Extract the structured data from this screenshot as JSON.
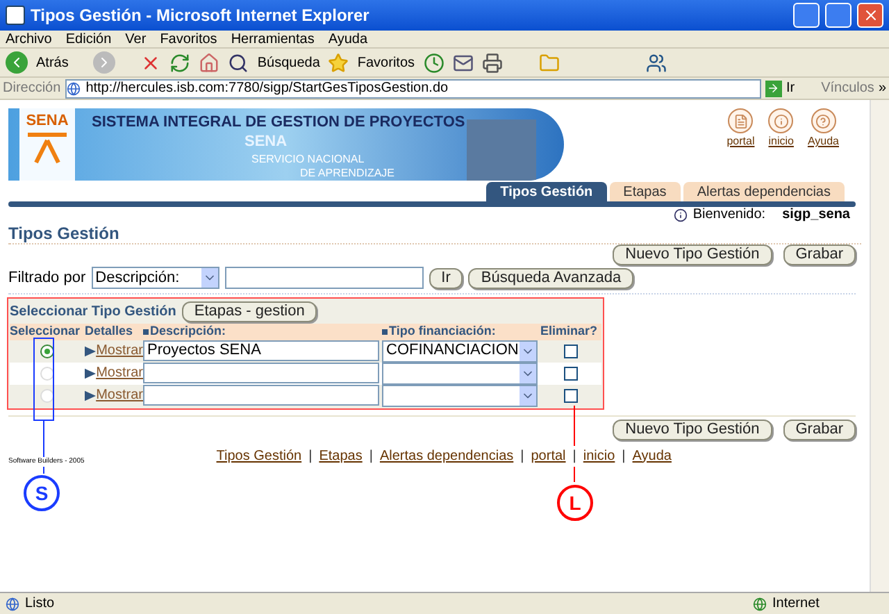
{
  "window": {
    "title": "Tipos Gestión - Microsoft Internet Explorer"
  },
  "menu": [
    "Archivo",
    "Edición",
    "Ver",
    "Favoritos",
    "Herramientas",
    "Ayuda"
  ],
  "toolbar": {
    "back": "Atrás",
    "search": "Búsqueda",
    "favorites": "Favoritos"
  },
  "address_bar": {
    "label": "Dirección",
    "url": "http://hercules.isb.com:7780/sigp/StartGesTiposGestion.do",
    "go": "Ir",
    "links": "Vínculos",
    "more": "»"
  },
  "banner": {
    "logo": "SENA",
    "title": "SISTEMA INTEGRAL DE GESTION DE PROYECTOS",
    "subtitle": "SENA",
    "line_1": "SERVICIO NACIONAL",
    "line_2": "DE APRENDIZAJE"
  },
  "header_links": [
    "portal",
    "inicio",
    "Ayuda"
  ],
  "tabs": [
    {
      "label": "Tipos Gestión",
      "selected": true
    },
    {
      "label": "Etapas",
      "selected": false
    },
    {
      "label": "Alertas dependencias",
      "selected": false
    }
  ],
  "welcome": {
    "label": "Bienvenido:",
    "user": "sigp_sena"
  },
  "page_title": "Tipos Gestión",
  "top_actions": [
    "Nuevo Tipo Gestión",
    "Grabar"
  ],
  "filter": {
    "label": "Filtrado por",
    "field": "Descripción:",
    "go": "Ir",
    "advanced": "Búsqueda Avanzada"
  },
  "table": {
    "caption": "Seleccionar Tipo Gestión",
    "caption_button": "Etapas - gestion",
    "columns": [
      "Seleccionar",
      "Detalles",
      "Descripción:",
      "Tipo financiación:",
      "Eliminar?"
    ],
    "rows": [
      {
        "selected": true,
        "details": "Mostrar",
        "description": "Proyectos SENA",
        "financing": "COFINANCIACION",
        "delete": false
      },
      {
        "selected": false,
        "details": "Mostrar",
        "description": "",
        "financing": "",
        "delete": false
      },
      {
        "selected": false,
        "details": "Mostrar",
        "description": "",
        "financing": "",
        "delete": false
      }
    ]
  },
  "bottom_actions": [
    "Nuevo Tipo Gestión",
    "Grabar"
  ],
  "copyright": "Software Builders - 2005",
  "footer_links": [
    "Tipos Gestión",
    "Etapas",
    "Alertas dependencias",
    "portal",
    "inicio",
    "Ayuda"
  ],
  "footer_separator": "|",
  "annotations": [
    {
      "label": "S",
      "color": "#1a3cff"
    },
    {
      "label": "L",
      "color": "#ff0000"
    }
  ],
  "status_bar": {
    "text": "Listo",
    "zone": "Internet"
  }
}
